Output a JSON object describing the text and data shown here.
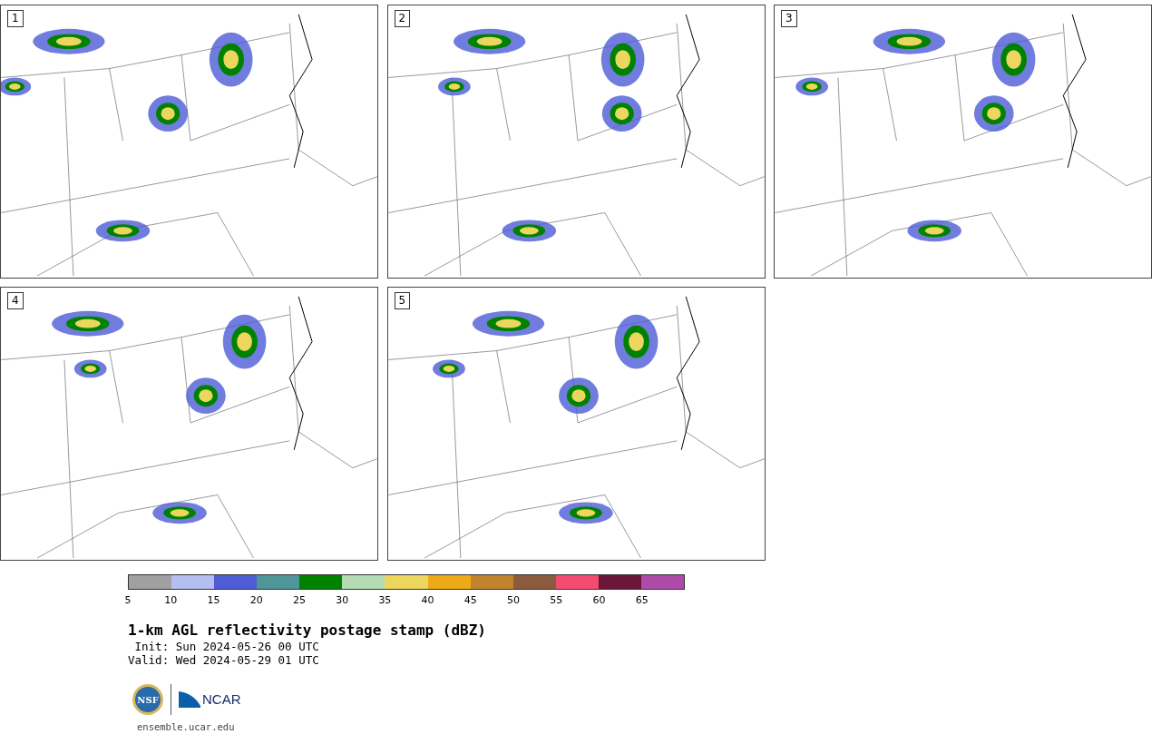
{
  "panels": [
    {
      "label": "1"
    },
    {
      "label": "2"
    },
    {
      "label": "3"
    },
    {
      "label": "4"
    },
    {
      "label": "5"
    }
  ],
  "colorbar": {
    "segments": [
      {
        "color": "#a0a0a0"
      },
      {
        "color": "#b4bef0"
      },
      {
        "color": "#4e5cd6"
      },
      {
        "color": "#4e9698"
      },
      {
        "color": "#008200"
      },
      {
        "color": "#b4dcb4"
      },
      {
        "color": "#ecd65e"
      },
      {
        "color": "#eeaa16"
      },
      {
        "color": "#c0842e"
      },
      {
        "color": "#8c5a3c"
      },
      {
        "color": "#f44c70"
      },
      {
        "color": "#6a1638"
      },
      {
        "color": "#ae4aa8"
      }
    ],
    "ticks": [
      "5",
      "10",
      "15",
      "20",
      "25",
      "30",
      "35",
      "40",
      "45",
      "50",
      "55",
      "60",
      "65"
    ]
  },
  "title": "1-km AGL reflectivity postage stamp (dBZ)",
  "init": " Init: Sun 2024-05-26 00 UTC",
  "valid": "Valid: Wed 2024-05-29 01 UTC",
  "logos": {
    "nsf": "NSF",
    "ncar": "NCAR"
  },
  "url": "ensemble.ucar.edu"
}
